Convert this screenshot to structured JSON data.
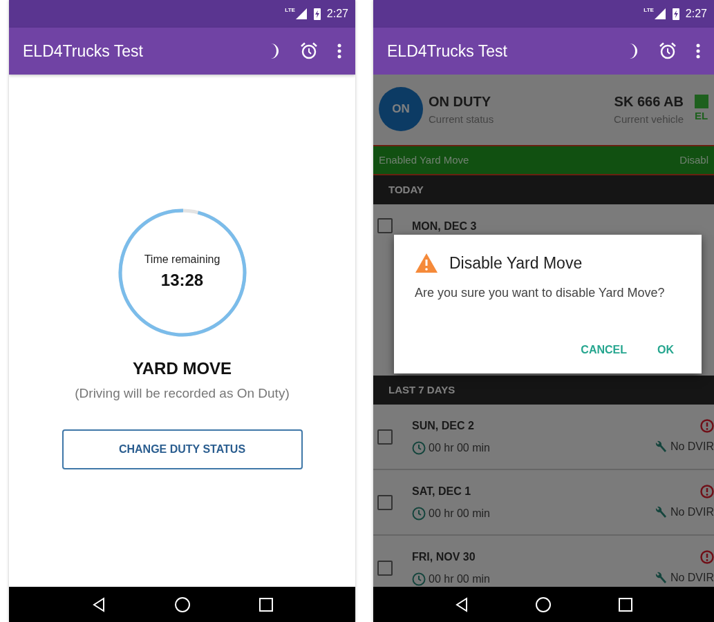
{
  "left_screen": {
    "status_bar": {
      "network": "LTE",
      "time": "2:27"
    },
    "app_bar": {
      "title": "ELD4Trucks Test"
    },
    "timer": {
      "label": "Time remaining",
      "value": "13:28",
      "level": 0.96
    },
    "status_title": "YARD MOVE",
    "status_note": "(Driving will be recorded as On Duty)",
    "button": "CHANGE DUTY STATUS"
  },
  "right_screen": {
    "status_bar": {
      "network": "LTE",
      "time": "2:27"
    },
    "app_bar": {
      "title": "ELD4Trucks Test"
    },
    "status_card": {
      "badge": "ON",
      "status": "ON DUTY",
      "status_caption": "Current status",
      "vehicle": "SK 666 AB",
      "vehicle_caption": "Current vehicle",
      "eld": "EL"
    },
    "yard_move_bar": {
      "text": "Enabled Yard Move",
      "action": "Disabl"
    },
    "sections": [
      {
        "title": "TODAY",
        "days": [
          {
            "date": "MON, DEC 3",
            "checked": false
          }
        ]
      },
      {
        "title": "LAST 7 DAYS",
        "days": [
          {
            "date": "SUN, DEC 2",
            "duration": "00 hr 00 min",
            "dvir": "No DVIR",
            "checked": false
          },
          {
            "date": "SAT, DEC 1",
            "duration": "00 hr 00 min",
            "dvir": "No DVIR",
            "checked": false
          },
          {
            "date": "FRI, NOV 30",
            "duration": "00 hr 00 min",
            "dvir": "No DVIR",
            "checked": false
          }
        ]
      }
    ],
    "dialog": {
      "title": "Disable Yard Move",
      "message": "Are you sure you want to disable Yard Move?",
      "buttons": [
        "CANCEL",
        "OK"
      ]
    }
  }
}
